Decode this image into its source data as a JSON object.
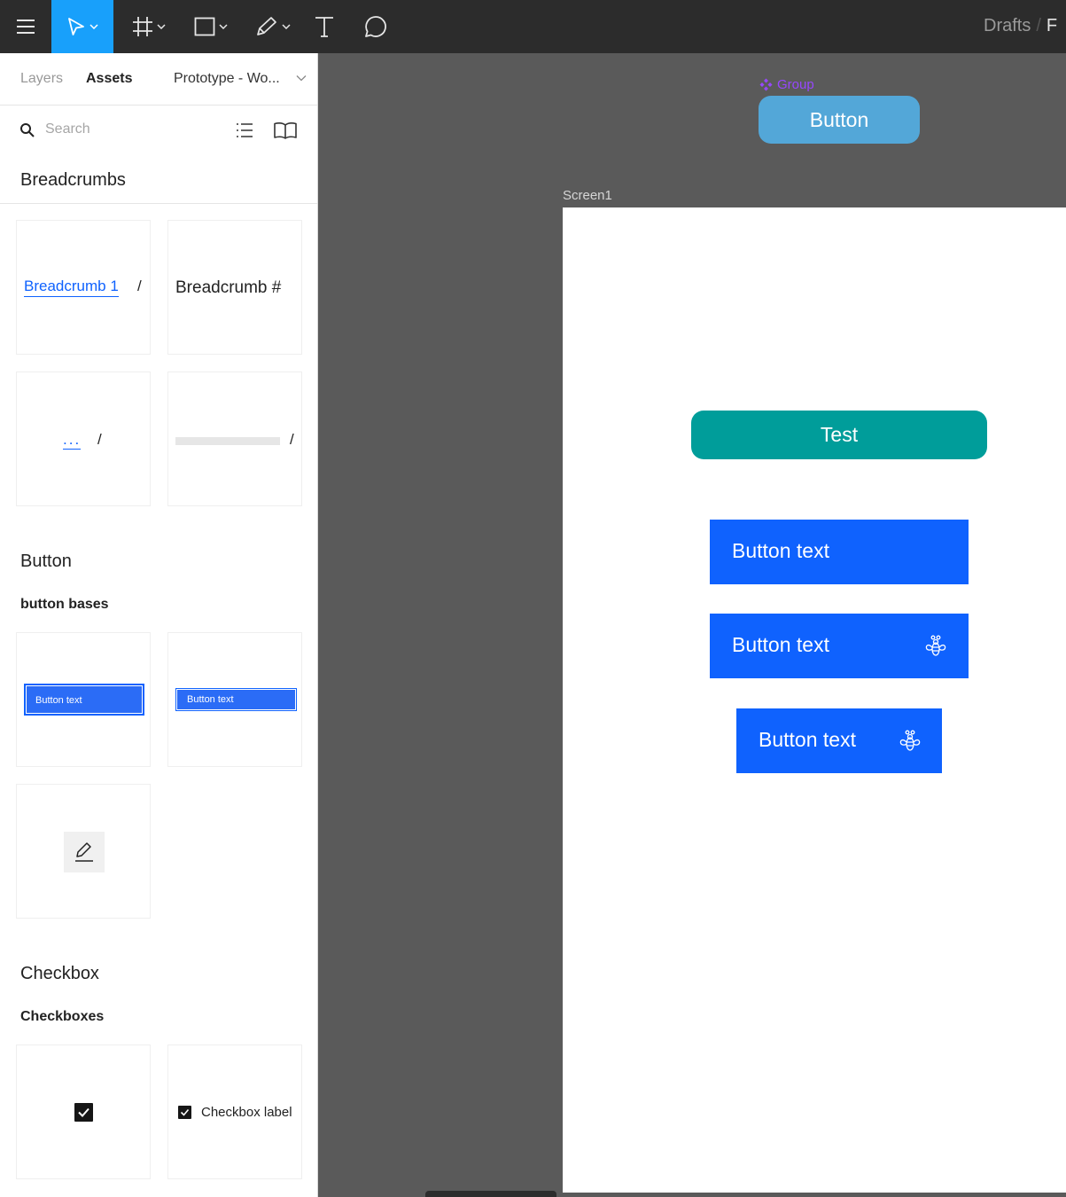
{
  "toolbar": {
    "tools": [
      "menu-icon",
      "move-tool",
      "frame-tool",
      "shape-tool",
      "pen-tool",
      "text-tool",
      "comment-tool"
    ],
    "accent": "#18a0fb",
    "breadcrumb": "Drafts",
    "breadcrumb_separator": "/",
    "breadcrumb_next": "F"
  },
  "panel": {
    "tabs": {
      "layers": "Layers",
      "assets": "Assets",
      "library": "Prototype - Wo..."
    },
    "search_placeholder": "Search",
    "sections": {
      "breadcrumbs": {
        "title": "Breadcrumbs",
        "tile1_link": "Breadcrumb 1",
        "tile1_sep": "/",
        "tile2_text": "Breadcrumb #",
        "tile3_dots": "...",
        "tile3_sep": "/",
        "tile4_sep": "/"
      },
      "button": {
        "title": "Button",
        "subtitle": "button bases",
        "tile1_label": "Button text",
        "tile2_label": "Button text"
      },
      "checkbox": {
        "title": "Checkbox",
        "subtitle": "Checkboxes",
        "tile2_label": "Checkbox label"
      }
    }
  },
  "canvas": {
    "group_label": "Group",
    "group_button_label": "Button",
    "frame_label": "Screen1",
    "test_button_label": "Test",
    "button1_label": "Button text",
    "button2_label": "Button text",
    "button3_label": "Button text",
    "colors": {
      "group_button": "#53a7d8",
      "test_button": "#009d9a",
      "primary_button": "#0f62fe",
      "group_label": "#9747ff"
    }
  }
}
